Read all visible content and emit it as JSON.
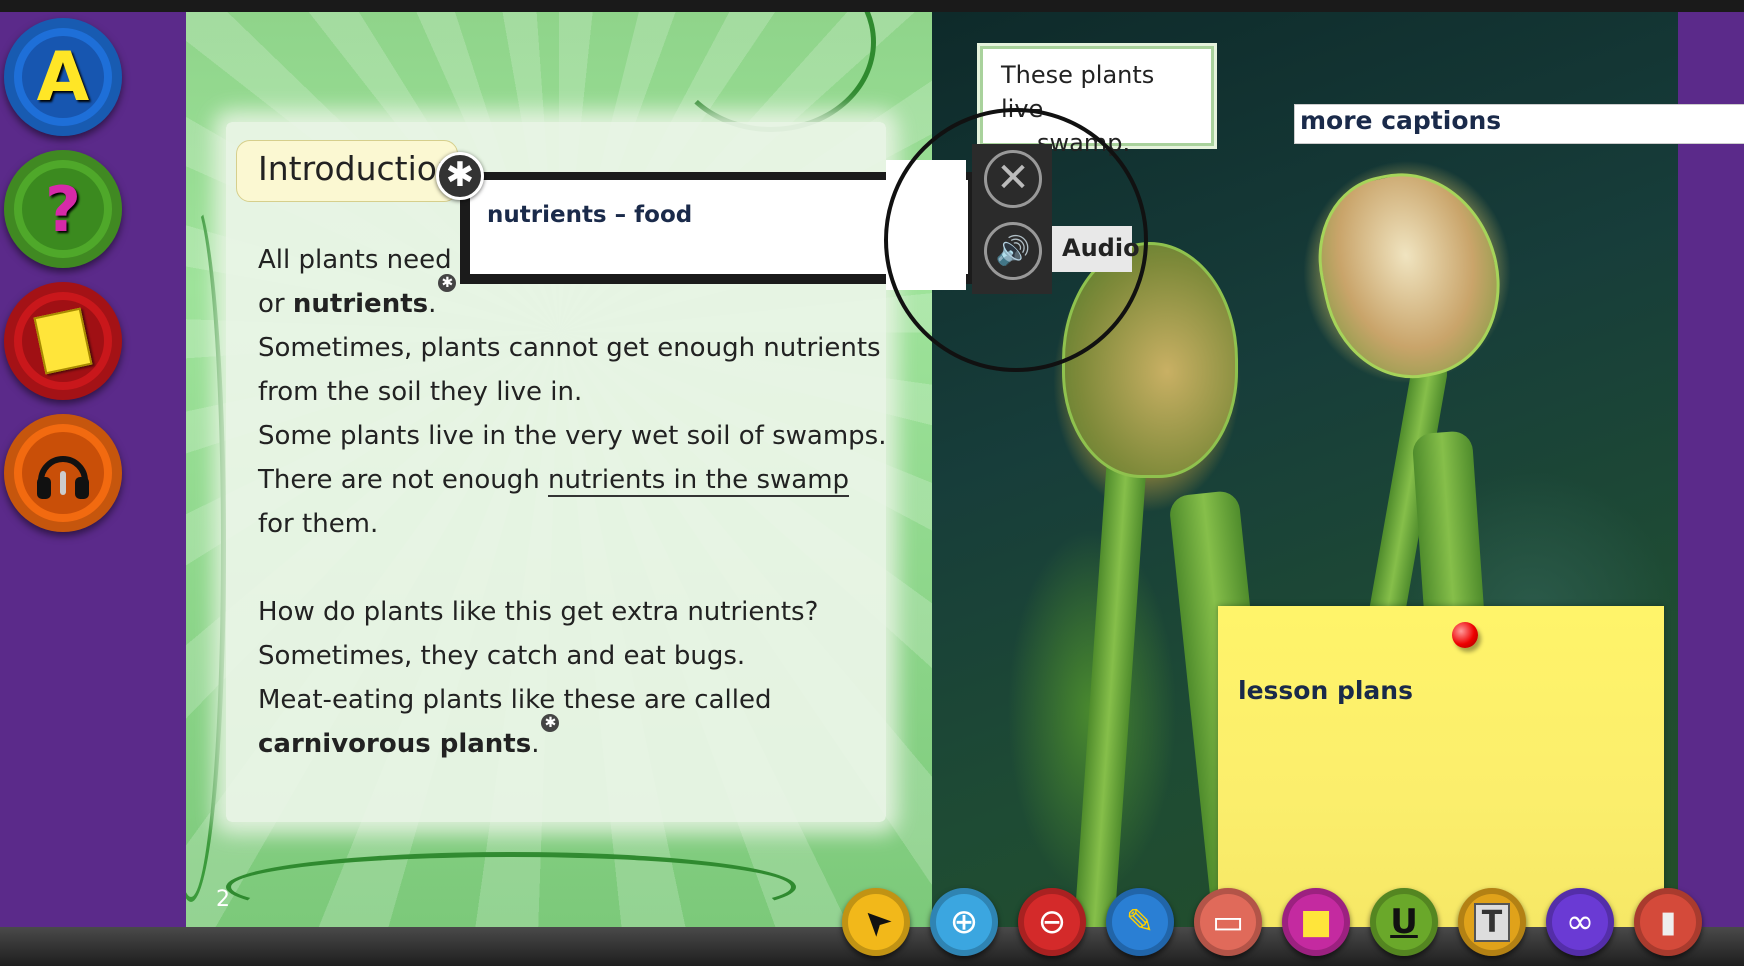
{
  "left_rail": [
    {
      "name": "a-button",
      "glyph": "A",
      "color": "#1e6fd8",
      "inner": "#1756b0"
    },
    {
      "name": "help-button",
      "glyph": "?",
      "color": "#4fa82a",
      "inner": "#3b8a1f"
    },
    {
      "name": "notes-button",
      "glyph": "",
      "color": "#c9171b",
      "inner": "#a01014"
    },
    {
      "name": "audio-button",
      "glyph": "",
      "color": "#f26a10",
      "inner": "#c94f08"
    }
  ],
  "page": {
    "intro_title": "Introduction",
    "lines": [
      {
        "pre": "All plants need ",
        "bold": "",
        "post": ""
      },
      {
        "pre": "or ",
        "bold": "nutrients",
        "post": "."
      },
      {
        "pre": "Sometimes, plants cannot get enough nutrients",
        "bold": "",
        "post": ""
      },
      {
        "pre": "from the soil they live in.",
        "bold": "",
        "post": ""
      },
      {
        "pre": "Some plants live in the very wet soil of swamps.",
        "bold": "",
        "post": ""
      },
      {
        "pre": "There are not enough ",
        "underline": "nutrients in the swamp",
        "bold": "",
        "post": ""
      },
      {
        "pre": "for them.",
        "bold": "",
        "post": ""
      },
      {
        "pre": "How do plants like this get extra nutrients?",
        "bold": "",
        "post": ""
      },
      {
        "pre": "Sometimes, they catch and eat bugs.",
        "bold": "",
        "post": ""
      },
      {
        "pre": "Meat-eating plants like these are called",
        "bold": "",
        "post": ""
      },
      {
        "pre": "",
        "bold": "carnivorous plants",
        "post": "."
      }
    ],
    "page_number": "2"
  },
  "popup": {
    "definition": "nutrients – food",
    "audio_label": "Audio"
  },
  "captions": {
    "caption1_line1": "These plants live",
    "caption1_line2": "swamp.",
    "caption2": "more captions"
  },
  "sticky_note": {
    "text": "lesson plans"
  },
  "toolbar": [
    {
      "name": "pointer-tool",
      "glyph": "➤",
      "color": "#f2b81a"
    },
    {
      "name": "zoom-in-tool",
      "glyph": "⊕",
      "color": "#3ba6e0"
    },
    {
      "name": "zoom-out-tool",
      "glyph": "⊖",
      "color": "#d42a2a"
    },
    {
      "name": "pen-tool",
      "glyph": "✎",
      "color": "#2a7fd4"
    },
    {
      "name": "eraser-tool",
      "glyph": "▭",
      "color": "#e06a5a"
    },
    {
      "name": "sticky-note-tool",
      "glyph": "■",
      "color": "#c42aa0"
    },
    {
      "name": "underline-tool",
      "glyph": "U",
      "color": "#6aa82a"
    },
    {
      "name": "text-tool",
      "glyph": "T",
      "color": "#e0a21a"
    },
    {
      "name": "link-tool",
      "glyph": "∞",
      "color": "#6a3ad4"
    },
    {
      "name": "clear-tool",
      "glyph": "▮",
      "color": "#d44a3a"
    }
  ]
}
